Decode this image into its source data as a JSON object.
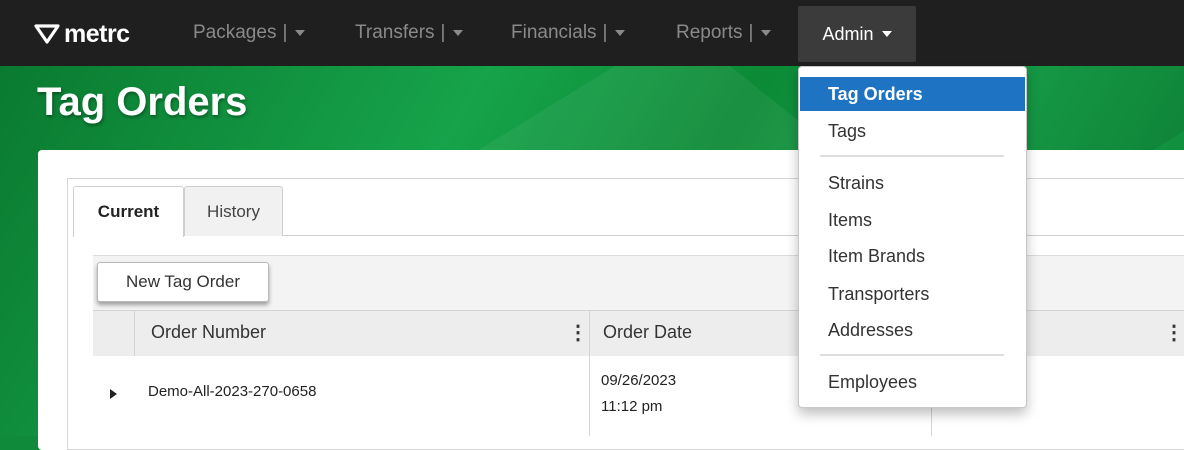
{
  "brand": {
    "name": "metrc",
    "logo_icon": "metrc-v-logo-icon"
  },
  "navbar": {
    "items": [
      {
        "label": "Packages"
      },
      {
        "label": "Transfers"
      },
      {
        "label": "Financials"
      },
      {
        "label": "Reports"
      }
    ],
    "separator": "|",
    "active_item": "Admin"
  },
  "page": {
    "title": "Tag Orders"
  },
  "tabs": [
    {
      "label": "Current",
      "active": true
    },
    {
      "label": "History",
      "active": false
    }
  ],
  "toolbar": {
    "new_tag_order_label": "New Tag Order"
  },
  "grid": {
    "columns": [
      "Order Number",
      "Order Date"
    ],
    "rows": [
      {
        "order_number": "Demo-All-2023-270-0658",
        "order_date": "09/26/2023",
        "order_time": "11:12 pm"
      }
    ]
  },
  "admin_menu": {
    "items": [
      {
        "label": "Tag Orders",
        "active": true
      },
      {
        "label": "Tags"
      },
      {
        "label": "Strains"
      },
      {
        "label": "Items"
      },
      {
        "label": "Item Brands"
      },
      {
        "label": "Transporters"
      },
      {
        "label": "Addresses"
      },
      {
        "label": "Employees"
      }
    ]
  },
  "colors": {
    "navbar": "#1f1f1f",
    "brand_green": "#16a34a",
    "menu_active": "#1e73c2"
  }
}
